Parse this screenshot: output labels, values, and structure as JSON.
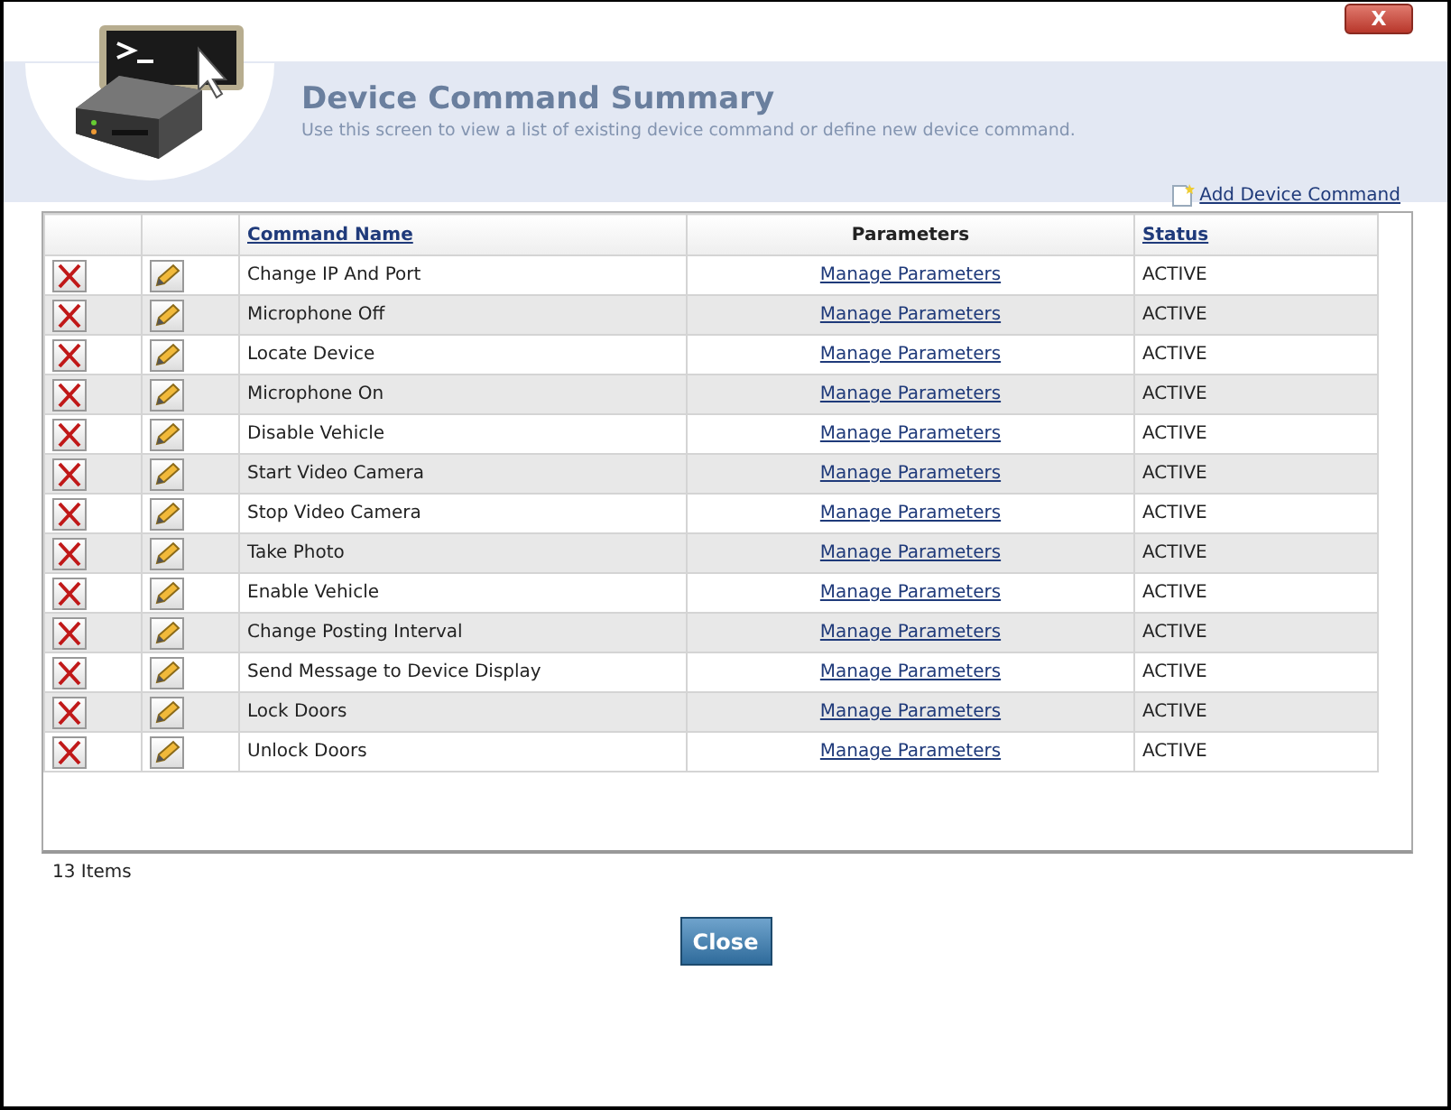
{
  "window": {
    "close_label": "X"
  },
  "header": {
    "title": "Device Command Summary",
    "subtitle": "Use this screen to view a list of existing device command or define new device command."
  },
  "add_link": "Add Device Command",
  "table": {
    "columns": [
      "Command Name",
      "Parameters",
      "Status"
    ],
    "rows": [
      {
        "name": "Change IP And Port",
        "parameters": "Manage Parameters",
        "status": "ACTIVE"
      },
      {
        "name": "Microphone Off",
        "parameters": "Manage Parameters",
        "status": "ACTIVE"
      },
      {
        "name": "Locate Device",
        "parameters": "Manage Parameters",
        "status": "ACTIVE"
      },
      {
        "name": "Microphone On",
        "parameters": "Manage Parameters",
        "status": "ACTIVE"
      },
      {
        "name": "Disable Vehicle",
        "parameters": "Manage Parameters",
        "status": "ACTIVE"
      },
      {
        "name": "Start Video Camera",
        "parameters": "Manage Parameters",
        "status": "ACTIVE"
      },
      {
        "name": "Stop Video Camera",
        "parameters": "Manage Parameters",
        "status": "ACTIVE"
      },
      {
        "name": "Take Photo",
        "parameters": "Manage Parameters",
        "status": "ACTIVE"
      },
      {
        "name": "Enable Vehicle",
        "parameters": "Manage Parameters",
        "status": "ACTIVE"
      },
      {
        "name": "Change Posting Interval",
        "parameters": "Manage Parameters",
        "status": "ACTIVE"
      },
      {
        "name": "Send Message to Device Display",
        "parameters": "Manage Parameters",
        "status": "ACTIVE"
      },
      {
        "name": "Lock Doors",
        "parameters": "Manage Parameters",
        "status": "ACTIVE"
      },
      {
        "name": "Unlock Doors",
        "parameters": "Manage Parameters",
        "status": "ACTIVE"
      }
    ]
  },
  "footer": {
    "count": "13 Items"
  },
  "buttons": [
    "Close"
  ]
}
